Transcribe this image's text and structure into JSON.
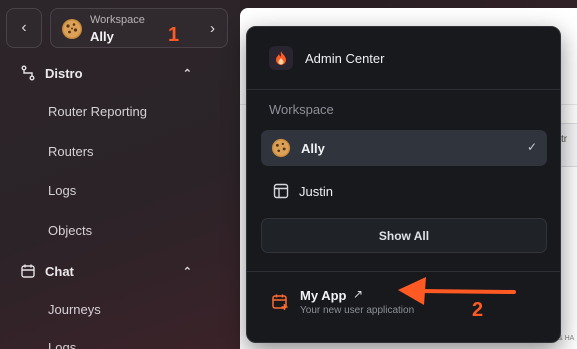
{
  "sidebar": {
    "back_icon": "chevron-left-icon",
    "workspace_switcher": {
      "label": "Workspace",
      "name": "Ally",
      "avatar": "cookie-icon",
      "chevron": "chevron-right-icon"
    },
    "sections": [
      {
        "label": "Distro",
        "icon": "route-icon",
        "items": [
          "Router Reporting",
          "Routers",
          "Logs",
          "Objects"
        ]
      },
      {
        "label": "Chat",
        "icon": "calendar-icon",
        "items": [
          "Journeys",
          "Logs"
        ]
      }
    ]
  },
  "dropdown": {
    "admin_center": {
      "label": "Admin Center",
      "icon": "flame-icon"
    },
    "workspace_heading": "Workspace",
    "workspaces": [
      {
        "name": "Ally",
        "icon": "cookie-icon",
        "selected": true
      },
      {
        "name": "Justin",
        "icon": "layout-icon",
        "selected": false
      }
    ],
    "show_all": "Show All",
    "my_app": {
      "title": "My App",
      "subtitle": "Your new user application",
      "icon": "calendar-plus-icon",
      "external_icon": "external-arrow-icon"
    }
  },
  "background": {
    "partial_text_1": "str",
    "partial_text_2": "& HA"
  },
  "annotations": {
    "step_1": "1",
    "step_2": "2",
    "color": "#ff5a24"
  },
  "colors": {
    "accent_orange": "#ff5a24",
    "panel_bg": "#17191d",
    "selected_bg": "#30343c"
  }
}
